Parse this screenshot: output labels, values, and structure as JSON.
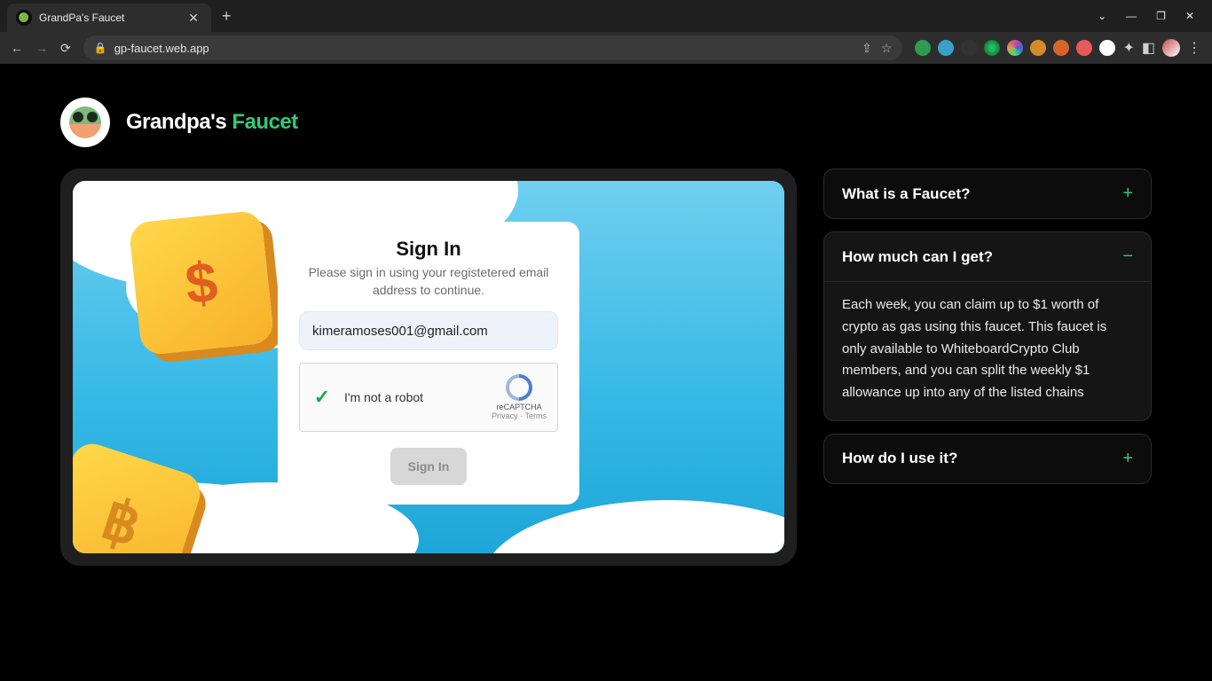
{
  "browser": {
    "tab_title": "GrandPa's Faucet",
    "url": "gp-faucet.web.app"
  },
  "brand": {
    "part1": "Grandpa's ",
    "part2": "Faucet"
  },
  "signin": {
    "title": "Sign In",
    "subtitle": "Please sign in using your registetered email address to continue.",
    "email_value": "kimeramoses001@gmail.com",
    "captcha_label": "I'm not a robot",
    "captcha_brand": "reCAPTCHA",
    "captcha_links": "Privacy  ·  Terms",
    "submit_label": "Sign In"
  },
  "faq": [
    {
      "q": "What is a Faucet?",
      "open": false,
      "a": ""
    },
    {
      "q": "How much can I get?",
      "open": true,
      "a": "Each week, you can claim up to $1 worth of crypto as gas using this faucet. This faucet is only available to WhiteboardCrypto Club members, and you can split the weekly $1 allowance up into any of the listed chains"
    },
    {
      "q": "How do I use it?",
      "open": false,
      "a": ""
    }
  ]
}
